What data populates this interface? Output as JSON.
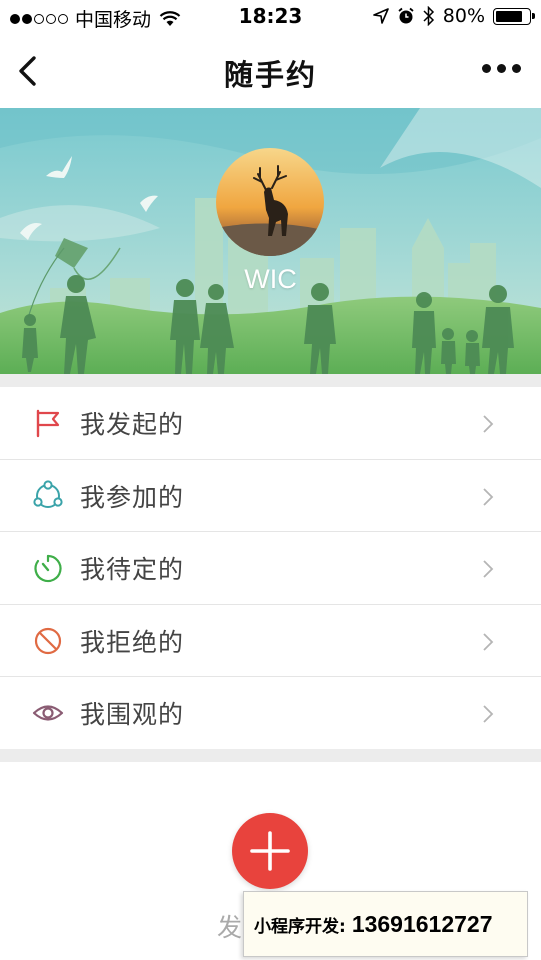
{
  "status_bar": {
    "carrier": "中国移动",
    "time": "18:23",
    "battery_percent": "80%",
    "battery_level": 0.8,
    "signal_bars_filled": 2,
    "signal_bars_total": 5
  },
  "nav": {
    "title": "随手约",
    "back_icon": "chevron-left-icon",
    "more_icon": "more-dots-icon"
  },
  "profile": {
    "name": "WIC",
    "avatar_description_icon": "deer-avatar"
  },
  "menu": {
    "items": [
      {
        "label": "我发起的",
        "icon": "flag-icon",
        "color": "#e0474c"
      },
      {
        "label": "我参加的",
        "icon": "group-icon",
        "color": "#3aa3a9"
      },
      {
        "label": "我待定的",
        "icon": "timer-icon",
        "color": "#3fae49"
      },
      {
        "label": "我拒绝的",
        "icon": "forbidden-icon",
        "color": "#e06a43"
      },
      {
        "label": "我围观的",
        "icon": "eye-icon",
        "color": "#8a5c73"
      }
    ]
  },
  "create": {
    "label": "发",
    "button_color": "#e8433d"
  },
  "dev_banner": {
    "label": "小程序开发:",
    "phone": "13691612727"
  }
}
